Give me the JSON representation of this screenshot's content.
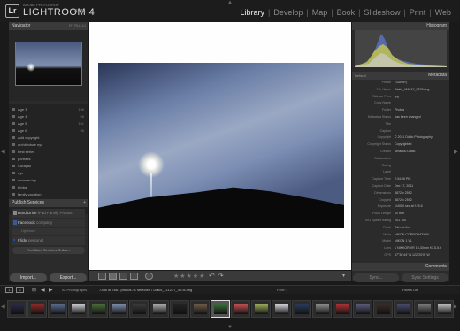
{
  "app": {
    "vendor": "ADOBE PHOTOSHOP",
    "name": "LIGHTROOM 4",
    "beta": "BETA",
    "badge": "Lr"
  },
  "modules": [
    "Library",
    "Develop",
    "Map",
    "Book",
    "Slideshow",
    "Print",
    "Web"
  ],
  "active_module": "Library",
  "navigator": {
    "title": "Navigator",
    "zoom_options": [
      "FIT",
      "FILL",
      "1:1"
    ]
  },
  "collections": [
    {
      "label": "Age 3",
      "count": "196"
    },
    {
      "label": "Age 4",
      "count": "56"
    },
    {
      "label": "Age 5",
      "count": "161"
    },
    {
      "label": "Age 6",
      "count": "96"
    },
    {
      "label": "Add copyright",
      "count": ""
    },
    {
      "label": "architecture nyc",
      "count": ""
    },
    {
      "label": "best series",
      "count": ""
    },
    {
      "label": "portraits",
      "count": ""
    },
    {
      "label": "Curaçao",
      "count": ""
    },
    {
      "label": "nyc",
      "count": ""
    },
    {
      "label": "summer trip",
      "count": ""
    },
    {
      "label": "bridge",
      "count": ""
    },
    {
      "label": "family vacation",
      "count": ""
    }
  ],
  "publish": {
    "title": "Publish Services",
    "services": [
      {
        "name": "Hard Drive",
        "detail": "iPad Family Photos"
      },
      {
        "name": "Facebook",
        "detail": "company"
      },
      {
        "name": "",
        "detail": "Lightroom"
      },
      {
        "name": "Flickr",
        "detail": "personal"
      }
    ],
    "find_more": "Find More Services Online..."
  },
  "left_buttons": {
    "import": "Import...",
    "export": "Export..."
  },
  "histogram": {
    "title": "Histogram"
  },
  "metadata": {
    "title": "Metadata",
    "preset_label": "Default",
    "rows": [
      {
        "k": "Preset",
        "v": "(SDBAY)"
      },
      {
        "k": "File Name",
        "v": "Diallo_111217_3078.dng"
      },
      {
        "k": "Sidecar Files",
        "v": "jpg"
      },
      {
        "k": "Copy Name",
        "v": ""
      },
      {
        "k": "Folder",
        "v": "Photos"
      },
      {
        "k": "Metadata Status",
        "v": "has been changed"
      },
      {
        "k": "Title",
        "v": ""
      },
      {
        "k": "Caption",
        "v": ""
      },
      {
        "k": "Copyright",
        "v": "© 2011 Diallo Photography"
      },
      {
        "k": "Copyright Status",
        "v": "Copyrighted"
      },
      {
        "k": "Creator",
        "v": "Amadou Diallo"
      },
      {
        "k": "Sublocation",
        "v": ""
      },
      {
        "k": "Rating",
        "v": "· · · · ·"
      },
      {
        "k": "Label",
        "v": ""
      },
      {
        "k": "Capture Time",
        "v": "2:34:06 PM"
      },
      {
        "k": "Capture Date",
        "v": "Dec 17, 2011"
      },
      {
        "k": "Dimensions",
        "v": "3872 x 2592"
      },
      {
        "k": "Cropped",
        "v": "3872 x 2592"
      },
      {
        "k": "Exposure",
        "v": "1/4000 sec at f / 5.6"
      },
      {
        "k": "Focal Length",
        "v": "10 mm"
      },
      {
        "k": "ISO Speed Rating",
        "v": "ISO 100"
      },
      {
        "k": "Flash",
        "v": "Did not fire"
      },
      {
        "k": "Make",
        "v": "NIKON CORPORATION"
      },
      {
        "k": "Model",
        "v": "NIKON 1 V1"
      },
      {
        "k": "Lens",
        "v": "1 NIKKOR VR 10-30mm f/3.5-5.6"
      },
      {
        "k": "GPS",
        "v": "47°36'44\" N 122°20'0\" W"
      }
    ]
  },
  "comments": {
    "title": "Comments"
  },
  "right_buttons": {
    "sync": "Sync...",
    "sync_settings": "Sync Settings"
  },
  "filmbar": {
    "pages": [
      "1",
      "2"
    ],
    "source": "All Photographs",
    "status": "7356 of 7661 photos / 1 selected / Diallo_111217_3078.dng",
    "filter_label": "Filter :",
    "filters_off": "Filters Off"
  },
  "colors": {
    "accent": "#eeeeee",
    "panel": "#2b2b2b",
    "background": "#1a1a1a"
  }
}
